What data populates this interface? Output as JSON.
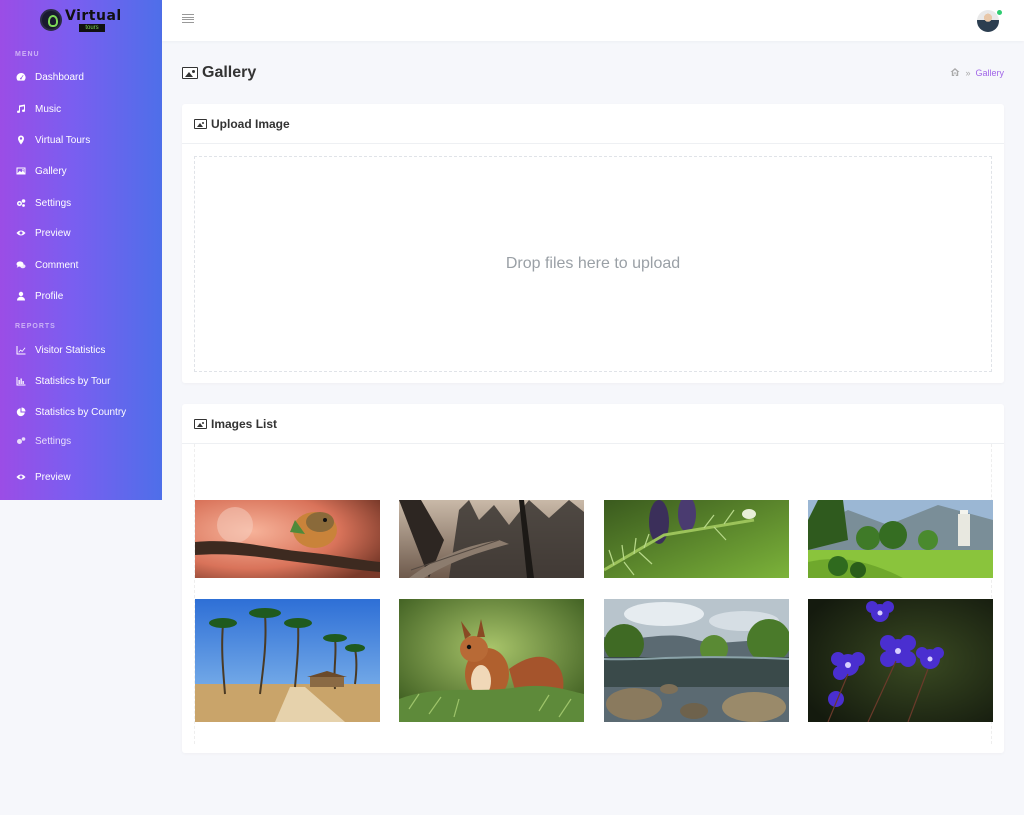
{
  "brand": {
    "title": "Virtual",
    "subtitle": "tours"
  },
  "sidebar": {
    "menu_heading": "MENU",
    "reports_heading": "REPORTS",
    "menu_items": [
      {
        "label": "Dashboard",
        "icon": "dashboard-icon"
      },
      {
        "label": "Music",
        "icon": "music-icon"
      },
      {
        "label": "Virtual Tours",
        "icon": "map-marker-icon"
      },
      {
        "label": "Gallery",
        "icon": "image-icon"
      },
      {
        "label": "Settings",
        "icon": "gears-icon"
      },
      {
        "label": "Preview",
        "icon": "eye-icon"
      },
      {
        "label": "Comment",
        "icon": "comments-icon"
      },
      {
        "label": "Profile",
        "icon": "user-icon"
      }
    ],
    "report_items": [
      {
        "label": "Visitor Statistics",
        "icon": "line-chart-icon"
      },
      {
        "label": "Statistics by Tour",
        "icon": "bar-chart-icon"
      },
      {
        "label": "Statistics by Country",
        "icon": "pie-chart-icon"
      }
    ],
    "extra_items": [
      {
        "label": "Settings",
        "icon": "gears-icon"
      },
      {
        "label": "Preview",
        "icon": "eye-icon"
      }
    ]
  },
  "page": {
    "title": "Gallery",
    "breadcrumb_current": "Gallery"
  },
  "upload": {
    "title": "Upload Image",
    "dropzone_text": "Drop files here to upload"
  },
  "images": {
    "title": "Images List",
    "items": [
      {
        "name": "bird-on-branch-image"
      },
      {
        "name": "forest-railway-image"
      },
      {
        "name": "pine-cones-image"
      },
      {
        "name": "park-garden-image"
      },
      {
        "name": "palm-beach-image"
      },
      {
        "name": "red-squirrel-image"
      },
      {
        "name": "pond-landscape-image"
      },
      {
        "name": "blue-flowers-image"
      }
    ]
  },
  "colors": {
    "sidebar_start": "#9b4de6",
    "sidebar_end": "#4e6fe9",
    "accent": "#a166e8",
    "online": "#2ecc71"
  }
}
